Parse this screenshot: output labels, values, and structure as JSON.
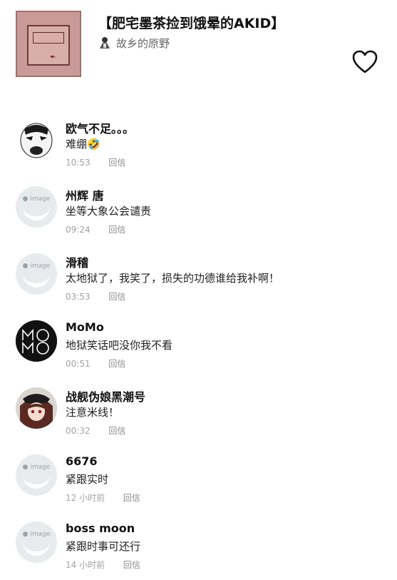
{
  "song": {
    "title": "【肥宅墨茶捡到饿晕的AKID】",
    "artist": "故乡的原野"
  },
  "icons": {
    "like": "heart-outline-icon",
    "emoji": "laughing-emoji-icon"
  },
  "comments": [
    {
      "user": "欧气不足。。。",
      "text": "难绷",
      "emoji": "🤣",
      "time": "10:53",
      "reply": "回信",
      "avatar": "meme-face"
    },
    {
      "user": "州辉 唐",
      "text": "坐等大象公会谴责",
      "time": "09:24",
      "reply": "回信",
      "avatar": "placeholder"
    },
    {
      "user": "滑稽",
      "text": "太地狱了，我笑了，损失的功德谁给我补啊！",
      "time": "03:53",
      "reply": "回信",
      "avatar": "placeholder"
    },
    {
      "user": "MoMo",
      "text": "地狱笑话吧没你我不看",
      "time": "00:51",
      "reply": "回信",
      "avatar": "momo-logo"
    },
    {
      "user": "战舰伪娘黑潮号",
      "text": "注意米线！",
      "time": "00:32",
      "reply": "回信",
      "avatar": "anime-girl"
    },
    {
      "user": "6676",
      "text": "紧跟实时",
      "time": "12 小时前",
      "reply": "回信",
      "avatar": "placeholder"
    },
    {
      "user": "boss moon",
      "text": "紧跟时事可还行",
      "time": "14 小时前",
      "reply": "回信",
      "avatar": "placeholder"
    }
  ]
}
